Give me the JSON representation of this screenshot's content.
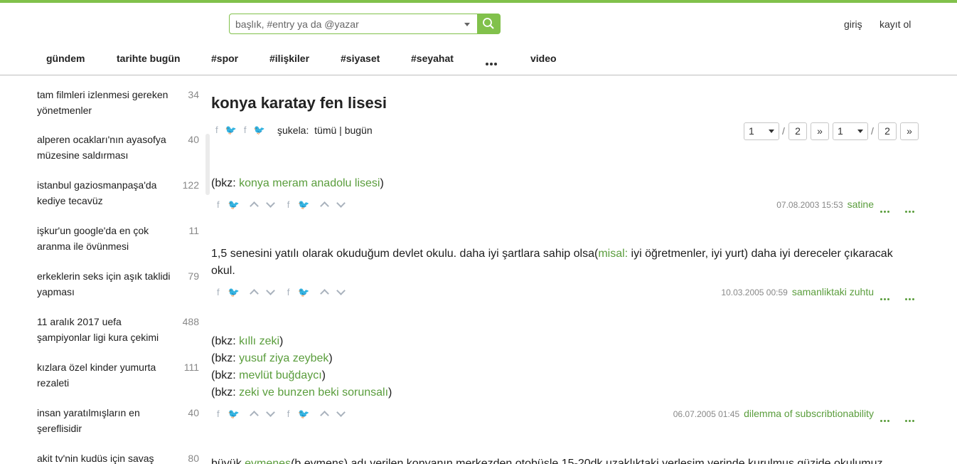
{
  "header": {
    "search": {
      "placeholder": "başlık, #entry ya da @yazar"
    },
    "auth": {
      "login": "giriş",
      "register": "kayıt ol"
    },
    "nav": [
      "gündem",
      "tarihte bugün",
      "#spor",
      "#ilişkiler",
      "#siyaset",
      "#seyahat",
      "video"
    ]
  },
  "colors": {
    "accent": "#81c14b",
    "link": "#5a9d3c"
  },
  "sidebar": {
    "topics": [
      {
        "title": "tam filmleri izlenmesi gereken yönetmenler",
        "count": "34"
      },
      {
        "title": "alperen ocakları'nın ayasofya müzesine saldırması",
        "count": "40"
      },
      {
        "title": "istanbul gaziosmanpaşa'da kediye tecavüz",
        "count": "122"
      },
      {
        "title": "işkur'un google'da en çok aranma ile övünmesi",
        "count": "11"
      },
      {
        "title": "erkeklerin seks için aşık taklidi yapması",
        "count": "79"
      },
      {
        "title": "11 aralık 2017 uefa şampiyonlar ligi kura çekimi",
        "count": "488"
      },
      {
        "title": "kızlara özel kinder yumurta rezaleti",
        "count": "111"
      },
      {
        "title": "insan yaratılmışların en şereflisidir",
        "count": "40"
      },
      {
        "title": "akit tv'nin kudüs için savaş",
        "count": "80"
      }
    ]
  },
  "topic": {
    "title": "konya karatay fen lisesi",
    "sukela_label": "şukela:",
    "filter_all": "tümü",
    "filter_sep": "|",
    "filter_today": "bugün",
    "pager": {
      "current": "1",
      "total": "2",
      "next": "»",
      "slash": "/"
    }
  },
  "entries": [
    {
      "lines": [
        {
          "pre": "(bkz: ",
          "link": "konya meram anadolu lisesi",
          "post": ")"
        }
      ],
      "date": "07.08.2003 15:53",
      "author": "satine"
    },
    {
      "text_pre": "1,5 senesini yatılı olarak okuduğum devlet okulu. daha iyi şartlara sahip olsa(",
      "text_link": "misal:",
      "text_post": " iyi öğretmenler, iyi yurt) daha iyi dereceler çıkaracak okul.",
      "date": "10.03.2005 00:59",
      "author": "samanliktaki zuhtu"
    },
    {
      "lines": [
        {
          "pre": "(bkz: ",
          "link": "kıllı zeki",
          "post": ")"
        },
        {
          "pre": "(bkz: ",
          "link": "yusuf ziya zeybek",
          "post": ")"
        },
        {
          "pre": "(bkz: ",
          "link": "mevlüt buğdaycı",
          "post": ")"
        },
        {
          "pre": "(bkz: ",
          "link": "zeki ve bunzen beki sorunsalı",
          "post": ")"
        }
      ],
      "date": "06.07.2005 01:45",
      "author": "dilemma of subscribtionability"
    },
    {
      "text_pre": "büyük ",
      "text_link": "eymenes",
      "text_post": "(b.eymens) adı verilen konyanın merkezden otobüsle 15-20dk uzaklıktaki yerleşim yerinde kurulmuş güzide okulumuz."
    }
  ],
  "icons": [
    "search-icon",
    "facebook-icon",
    "twitter-icon",
    "upvote-icon",
    "downvote-icon",
    "more-icon"
  ]
}
